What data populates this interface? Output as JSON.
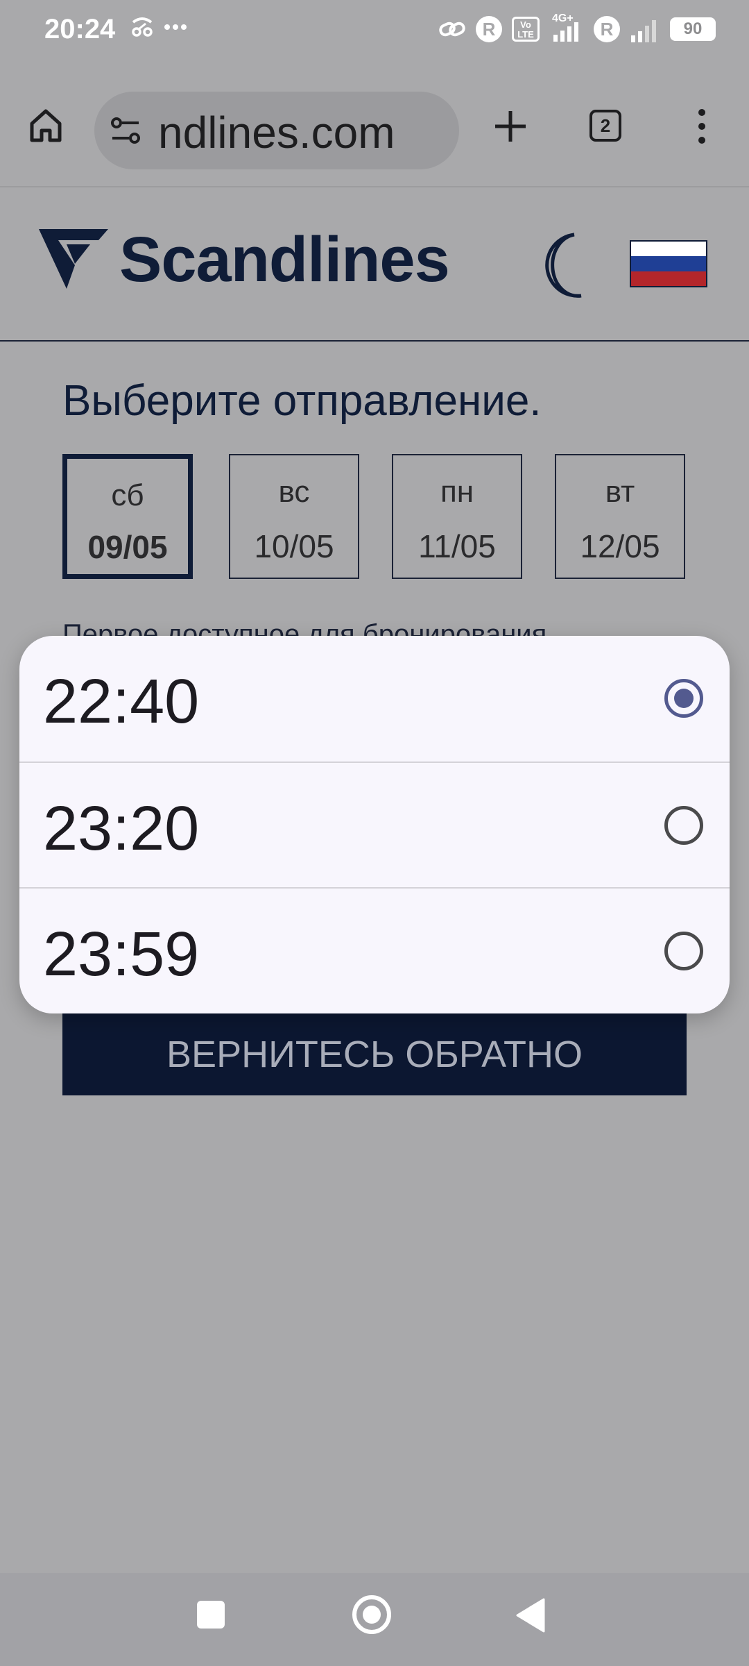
{
  "status_bar": {
    "time": "20:24",
    "network_label": "4G+",
    "roaming_label_1": "R",
    "roaming_label_2": "R",
    "volte_label": "Vo LTE",
    "battery": "90"
  },
  "browser": {
    "url": "ndlines.com",
    "tab_count": "2"
  },
  "site": {
    "logo_text": "Scandlines",
    "heading": "Выберите отправление.",
    "dates": [
      {
        "day": "сб",
        "date": "09/05",
        "selected": true
      },
      {
        "day": "вс",
        "date": "10/05",
        "selected": false
      },
      {
        "day": "пн",
        "date": "11/05",
        "selected": false
      },
      {
        "day": "вт",
        "date": "12/05",
        "selected": false
      }
    ],
    "first_available_text": "Первое доступное для бронирования",
    "back_button": "ВЕРНИТЕСЬ ОБРАТНО",
    "flag_colors": [
      "#ffffff",
      "#1f3f95",
      "#b3262b"
    ]
  },
  "time_picker": {
    "options": [
      {
        "label": "22:40",
        "selected": true
      },
      {
        "label": "23:20",
        "selected": false
      },
      {
        "label": "23:59",
        "selected": false
      }
    ]
  },
  "colors": {
    "brand_navy": "#0f1c37",
    "radio_accent": "#535a8f"
  }
}
